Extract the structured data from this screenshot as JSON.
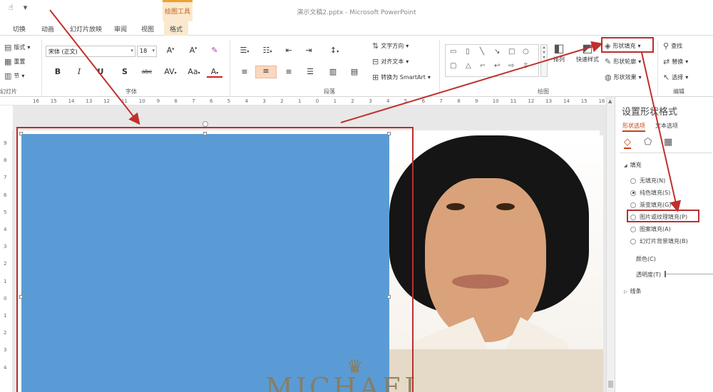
{
  "window": {
    "title": "演示文稿2.pptx - Microsoft PowerPoint",
    "context_group": "绘图工具"
  },
  "tabs": [
    "切换",
    "动画",
    "幻灯片放映",
    "审阅",
    "视图",
    "格式"
  ],
  "ribbon": {
    "slides": {
      "layout": "版式",
      "reset": "重置",
      "section": "节",
      "group_label": "幻灯片"
    },
    "font": {
      "name": "宋体 (正文)",
      "size": "18",
      "group_label": "字体",
      "bold": "B",
      "italic": "I",
      "strike_s": "S",
      "strike_abc": "abc",
      "spacing": "AV",
      "case": "Aa",
      "color": "A"
    },
    "paragraph": {
      "text_direction": "文字方向",
      "align_text": "对齐文本",
      "smartart": "转换为 SmartArt",
      "group_label": "段落"
    },
    "drawing": {
      "arrange": "排列",
      "quick_styles": "快速样式",
      "shape_fill": "形状填充",
      "shape_outline": "形状轮廓",
      "shape_effects": "形状效果",
      "group_label": "绘图"
    },
    "editing": {
      "find": "查找",
      "replace": "替换",
      "select": "选择",
      "group_label": "编辑"
    }
  },
  "ruler": {
    "h_ticks": [
      "16",
      "15",
      "14",
      "13",
      "12",
      "11",
      "10",
      "9",
      "8",
      "7",
      "6",
      "5",
      "4",
      "3",
      "2",
      "1",
      "0",
      "1",
      "2",
      "3",
      "4",
      "5",
      "6",
      "7",
      "8",
      "9",
      "10",
      "11",
      "12",
      "13",
      "14",
      "15",
      "16"
    ],
    "v_ticks": [
      "9",
      "8",
      "7",
      "6",
      "5",
      "4",
      "3",
      "2",
      "1",
      "0",
      "1",
      "2",
      "3",
      "4"
    ]
  },
  "slide": {
    "watermark": "MICHAEL"
  },
  "pane": {
    "title": "设置形状格式",
    "tabs": [
      "形状选项",
      "文本选项"
    ],
    "fill_section": "填充",
    "fill_options": [
      {
        "label": "无填充(N)",
        "checked": false
      },
      {
        "label": "纯色填充(S)",
        "checked": true
      },
      {
        "label": "渐变填充(G)",
        "checked": false
      },
      {
        "label": "图片或纹理填充(P)",
        "checked": false
      },
      {
        "label": "图案填充(A)",
        "checked": false
      },
      {
        "label": "幻灯片背景填充(B)",
        "checked": false
      }
    ],
    "color_label": "颜色(C)",
    "transparency_label": "透明度(T)",
    "line_section": "线条"
  },
  "colors": {
    "shape_fill": "#5b9bd5",
    "annotation": "#b83030",
    "context_tab": "#fbe9cf"
  }
}
